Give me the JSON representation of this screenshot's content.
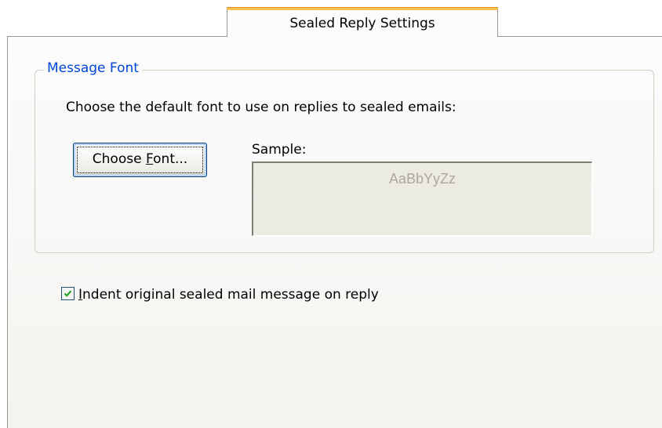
{
  "tab": {
    "label": "Sealed Reply Settings"
  },
  "group": {
    "legend": "Message Font",
    "description": "Choose the default font to use on replies to sealed emails:",
    "choose_font_button": {
      "before": "Choose ",
      "mnemonic": "F",
      "after": "ont..."
    },
    "sample_label": "Sample:",
    "sample_text": "AaBbYyZz"
  },
  "indent_option": {
    "checked": true,
    "mnemonic": "I",
    "label_rest": "ndent original sealed mail message on reply"
  },
  "colors": {
    "tab_highlight": "#f7c350",
    "group_legend": "#0046d5",
    "checkmark": "#21a121",
    "sample_text": "#aca899"
  },
  "icons": {
    "checkbox": "checkmark-icon"
  }
}
